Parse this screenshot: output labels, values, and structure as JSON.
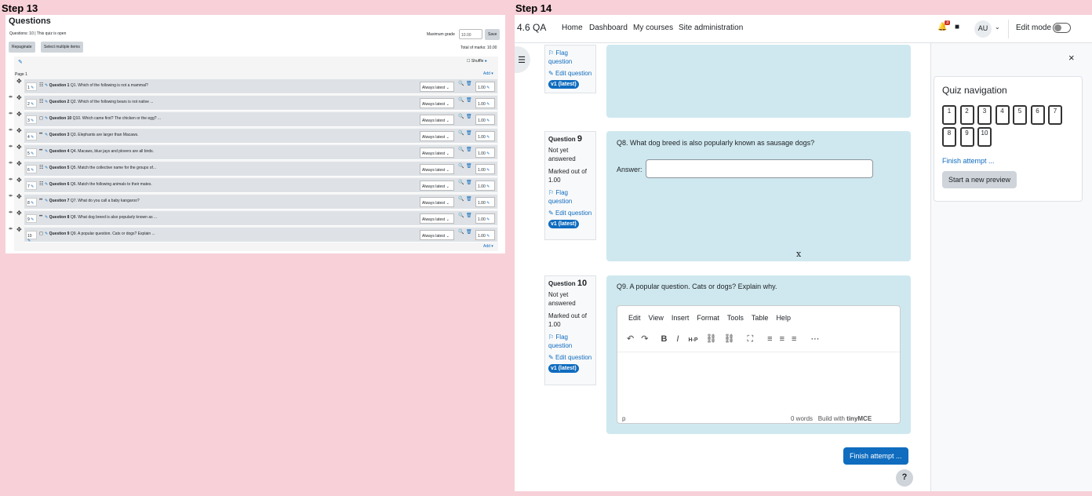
{
  "steps": {
    "left": "Step 13",
    "right": "Step 14"
  },
  "editor": {
    "title": "Questions",
    "meta": "Questions: 10 | This quiz is open",
    "max_grade_label": "Maximum grade",
    "max_grade_value": "10.00",
    "save": "Save",
    "repaginate": "Repaginate",
    "select_multiple": "Select multiple items",
    "total_marks": "Total of marks: 10.00",
    "shuffle": "Shuffle",
    "page": "Page 1",
    "add": "Add",
    "slots": [
      {
        "num": "1",
        "type": "multichoice",
        "name": "Question 1",
        "text": "Q1. Which of the following is not a mammal?",
        "version": "Always latest",
        "mark": "1.00"
      },
      {
        "num": "2",
        "type": "multichoice",
        "name": "Question 2",
        "text": "Q2. Which of the following bears is not native ...",
        "version": "Always latest",
        "mark": "1.00"
      },
      {
        "num": "3",
        "type": "truefalse",
        "name": "Question 10",
        "text": "Q10. Which came first? The chicken or the egg? ...",
        "version": "Always latest",
        "mark": "1.00"
      },
      {
        "num": "4",
        "type": "shortanswer",
        "name": "Question 3",
        "text": "Q3. Elephants are larger than Macaws.",
        "version": "Always latest",
        "mark": "1.00"
      },
      {
        "num": "5",
        "type": "shortanswer",
        "name": "Question 4",
        "text": "Q4. Macaws, blue jays and plovers are all birds.",
        "version": "Always latest",
        "mark": "1.00"
      },
      {
        "num": "6",
        "type": "match",
        "name": "Question 5",
        "text": "Q5. Match the collective name for the groups of...",
        "version": "Always latest",
        "mark": "1.00"
      },
      {
        "num": "7",
        "type": "multichoice",
        "name": "Question 6",
        "text": "Q6. Match the following animals to their mates.",
        "version": "Always latest",
        "mark": "1.00"
      },
      {
        "num": "8",
        "type": "shortanswer",
        "name": "Question 7",
        "text": "Q7. What do you call a baby kangaroo?",
        "version": "Always latest",
        "mark": "1.00"
      },
      {
        "num": "9",
        "type": "shortanswer",
        "name": "Question 8",
        "text": "Q8. What dog breed is also popularly known as ...",
        "version": "Always latest",
        "mark": "1.00"
      },
      {
        "num": "10",
        "type": "essay",
        "name": "Question 9",
        "text": "Q9. A popular question. Cats or dogs? Explain ...",
        "version": "Always latest",
        "mark": "1.00"
      }
    ]
  },
  "attempt": {
    "brand": "4.6 QA",
    "nav": [
      "Home",
      "Dashboard",
      "My courses",
      "Site administration"
    ],
    "notif_count": "3",
    "avatar": "AU",
    "edit_mode": "Edit mode",
    "prev_q": {
      "flag": "Flag question",
      "edit": "Edit question",
      "badge": "v1 (latest)"
    },
    "q9": {
      "label": "Question",
      "num": "9",
      "status": "Not yet answered",
      "marked": "Marked out of 1.00",
      "flag": "Flag question",
      "edit": "Edit question",
      "badge": "v1 (latest)",
      "text": "Q8. What dog breed is also popularly known as sausage dogs?",
      "answer_label": "Answer:",
      "x": "x"
    },
    "q10": {
      "label": "Question",
      "num": "10",
      "status": "Not yet answered",
      "marked": "Marked out of 1.00",
      "flag": "Flag question",
      "edit": "Edit question",
      "badge": "v1 (latest)",
      "text": "Q9. A popular question. Cats or dogs? Explain why.",
      "menus": [
        "Edit",
        "View",
        "Insert",
        "Format",
        "Tools",
        "Table",
        "Help"
      ],
      "status_path": "p",
      "words": "0 words",
      "build": "Build with",
      "tinymce": "tinyMCE"
    },
    "finish_btn": "Finish attempt ...",
    "help": "?",
    "quiz_nav": {
      "title": "Quiz navigation",
      "buttons": [
        "1",
        "2",
        "3",
        "4",
        "5",
        "6",
        "7",
        "8",
        "9",
        "10"
      ],
      "finish_link": "Finish attempt ...",
      "new_preview": "Start a new preview"
    },
    "close": "×"
  }
}
